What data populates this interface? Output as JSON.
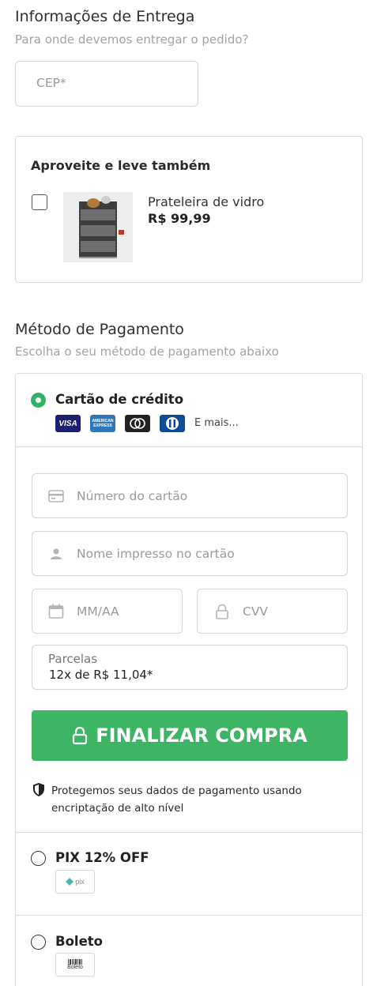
{
  "delivery": {
    "title": "Informações de Entrega",
    "subtitle": "Para onde devemos entregar o pedido?",
    "cep_placeholder": "CEP*"
  },
  "upsell": {
    "title": "Aproveite e leve também",
    "product_name": "Prateleira de vidro",
    "product_price": "R$ 99,99",
    "checked": false
  },
  "payment": {
    "title": "Método de Pagamento",
    "subtitle": "Escolha o seu método de pagamento abaixo",
    "credit_card": {
      "label": "Cartão de crédito",
      "brands": [
        "visa",
        "american-express",
        "mastercard",
        "diners"
      ],
      "more_label": "E mais...",
      "card_number_placeholder": "Número do cartão",
      "card_name_placeholder": "Nome impresso no cartão",
      "expiry_placeholder": "MM/AA",
      "cvv_placeholder": "CVV",
      "installments_label": "Parcelas",
      "installments_value": "12x de R$ 11,04*",
      "submit_label": "FINALIZAR COMPRA",
      "security_note": "Protegemos seus dados de pagamento usando encriptação de alto nível"
    },
    "pix": {
      "label": "PIX 12% OFF",
      "logo_text": "pix"
    },
    "boleto": {
      "label": "Boleto",
      "logo_text": "Boleto"
    }
  },
  "colors": {
    "accent": "#3db565",
    "radio_selected": "#2fb36b",
    "border": "#dcdcdc"
  }
}
